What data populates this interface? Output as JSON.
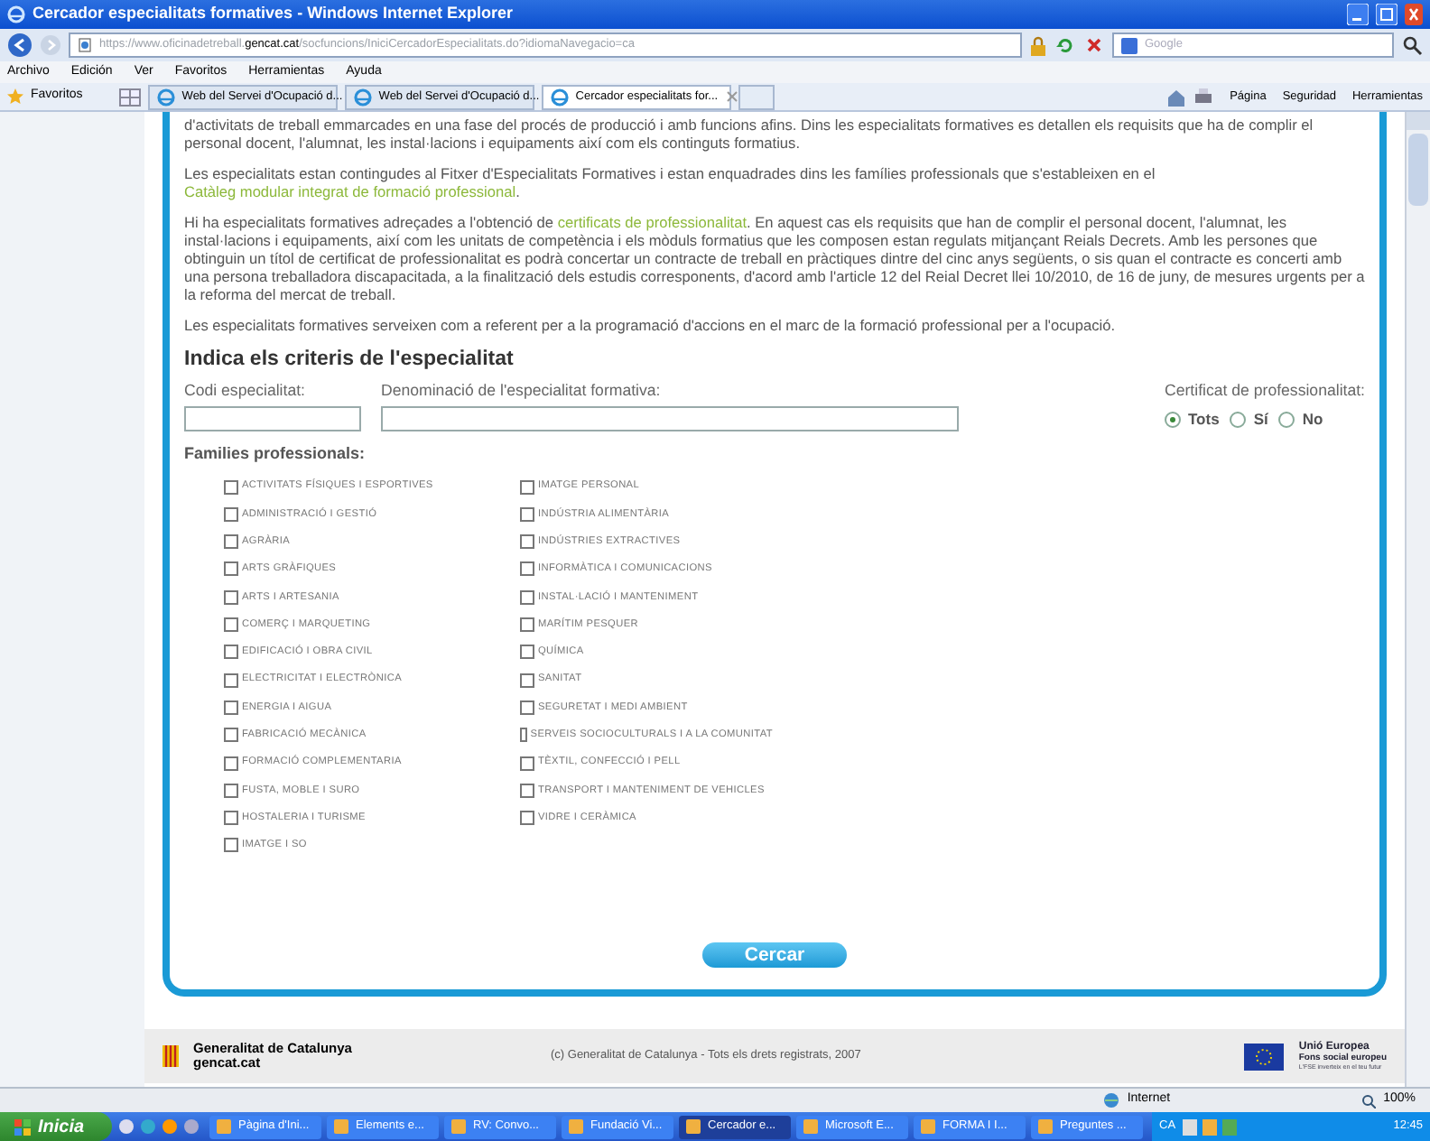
{
  "window": {
    "title": "Cercador especialitats formatives - Windows Internet Explorer"
  },
  "address_bar": {
    "url": "https://www.oficinadetreball.**gencat.cat**/socfuncions/IniciCercadorEspecialitats.do?idiomaNavegacio=ca",
    "search_placeholder": "Google"
  },
  "menu": [
    "Archivo",
    "Edición",
    "Ver",
    "Favoritos",
    "Herramientas",
    "Ayuda"
  ],
  "favorites_bar": {
    "label": "Favoritos",
    "tabs": [
      {
        "label": "Web del Servei d'Ocupació d...",
        "selected": false
      },
      {
        "label": "Web del Servei d'Ocupació d...",
        "selected": false
      },
      {
        "label": "Cercador especialitats for...",
        "selected": true
      }
    ],
    "commands": [
      "Página",
      "Seguridad",
      "Herramientas"
    ]
  },
  "paragraphs": [
    [
      {
        "text": "d'activitats de treball emmarcades en una fase del procés de producció i amb funcions afins. Dins les especialitats formatives es detallen els requisits que ha de complir el personal docent, l'alumnat, les instal·lacions i equipaments així com els continguts formatius."
      }
    ],
    [
      {
        "text": "Les especialitats estan contingudes al Fitxer d'Especialitats Formatives i estan enquadrades dins les famílies professionals que s'estableixen en el "
      },
      {
        "text": "Catàleg modular integrat de formació professional",
        "link": true
      },
      {
        "text": "."
      }
    ],
    [
      {
        "text": "Hi ha especialitats formatives adreçades a l'obtenció de "
      },
      {
        "text": "certificats de professionalitat",
        "link": true
      },
      {
        "text": ". En aquest cas els requisits que han de complir el personal docent, l'alumnat, les instal·lacions i equipaments, així com les unitats de competència i els mòduls formatius que les composen estan regulats mitjançant Reials Decrets. Amb les persones que obtinguin un títol de certificat de professionalitat es podrà concertar un contracte de treball en pràctiques dintre del cinc anys següents, o sis quan el contracte es concerti amb una persona treballadora discapacitada, a la finalització dels estudis corresponents, d'acord amb l'article 12 del Reial Decret llei 10/2010, de 16 de juny, de mesures urgents per a la reforma del mercat de treball."
      }
    ],
    [
      {
        "text": "Les especialitats formatives serveixen com a referent per a la programació d'accions en el marc de la formació professional per a l'ocupació."
      }
    ]
  ],
  "form": {
    "heading": "Indica els criteris de l'especialitat",
    "code_label": "Codi especialitat:",
    "name_label": "Denominació de l'especialitat formativa:",
    "certificate": {
      "label": "Certificat de professionalitat:",
      "options": [
        {
          "label": "Tots",
          "selected": true
        },
        {
          "label": "Sí",
          "selected": false
        },
        {
          "label": "No",
          "selected": false
        }
      ]
    },
    "families_label": "Families professionals:",
    "families": [
      [
        {
          "label": "ACTIVITATS FÍSIQUES I ESPORTIVES",
          "checked": false
        },
        {
          "label": "ADMINISTRACIÓ I GESTIÓ",
          "checked": false
        },
        {
          "label": "AGRÀRIA",
          "checked": false
        },
        {
          "label": "ARTS GRÀFIQUES",
          "checked": false
        },
        {
          "label": "ARTS I ARTESANIA",
          "checked": false
        },
        {
          "label": "COMERÇ I MARQUETING",
          "checked": false
        },
        {
          "label": "EDIFICACIÓ I OBRA CIVIL",
          "checked": false
        },
        {
          "label": "ELECTRICITAT I ELECTRÒNICA",
          "checked": false
        },
        {
          "label": "ENERGIA I AIGUA",
          "checked": false
        },
        {
          "label": "FABRICACIÓ MECÀNICA",
          "checked": false
        },
        {
          "label": "FORMACIÓ COMPLEMENTARIA",
          "checked": false
        },
        {
          "label": "FUSTA, MOBLE I SURO",
          "checked": false
        },
        {
          "label": "HOSTALERIA I TURISME",
          "checked": false
        },
        {
          "label": "IMATGE I SO",
          "checked": false
        }
      ],
      [
        {
          "label": "IMATGE PERSONAL",
          "checked": false
        },
        {
          "label": "INDÚSTRIA ALIMENTÀRIA",
          "checked": false
        },
        {
          "label": "INDÚSTRIES EXTRACTIVES",
          "checked": false
        },
        {
          "label": "INFORMÀTICA I COMUNICACIONS",
          "checked": false
        },
        {
          "label": "INSTAL·LACIÓ I MANTENIMENT",
          "checked": false
        },
        {
          "label": "MARÍTIM PESQUER",
          "checked": false
        },
        {
          "label": "QUÍMICA",
          "checked": false
        },
        {
          "label": "SANITAT",
          "checked": false
        },
        {
          "label": "SEGURETAT I MEDI AMBIENT",
          "checked": false
        },
        {
          "label": "SERVEIS SOCIOCULTURALS I A LA COMUNITAT",
          "checked": false
        },
        {
          "label": "TÈXTIL, CONFECCIÓ I PELL",
          "checked": false
        },
        {
          "label": "TRANSPORT I MANTENIMENT DE VEHICLES",
          "checked": false
        },
        {
          "label": "VIDRE I CERÀMICA",
          "checked": false
        }
      ]
    ],
    "submit": "Cercar"
  },
  "footer": {
    "org": "Generalitat de Catalunya",
    "site": "gencat.cat",
    "copyright": "(c) Generalitat de Catalunya - Tots els drets registrats, 2007",
    "eu": "Unió Europea",
    "fund": "Fons social europeu",
    "motto": "L'FSE inverteix en el teu futur"
  },
  "status_bar": {
    "zone": "Internet",
    "zoom": "100%"
  },
  "taskbar": {
    "start": "Inicia",
    "tasks": [
      {
        "label": "Pàgina d'Ini...",
        "selected": false
      },
      {
        "label": "Elements e...",
        "selected": false
      },
      {
        "label": "RV: Convo...",
        "selected": false
      },
      {
        "label": "Fundació Vi...",
        "selected": false
      },
      {
        "label": "Cercador e...",
        "selected": true
      },
      {
        "label": "Microsoft E...",
        "selected": false
      },
      {
        "label": "FORMA I I...",
        "selected": false
      },
      {
        "label": "Preguntes ...",
        "selected": false
      }
    ],
    "language": "CA",
    "clock": "12:45"
  }
}
